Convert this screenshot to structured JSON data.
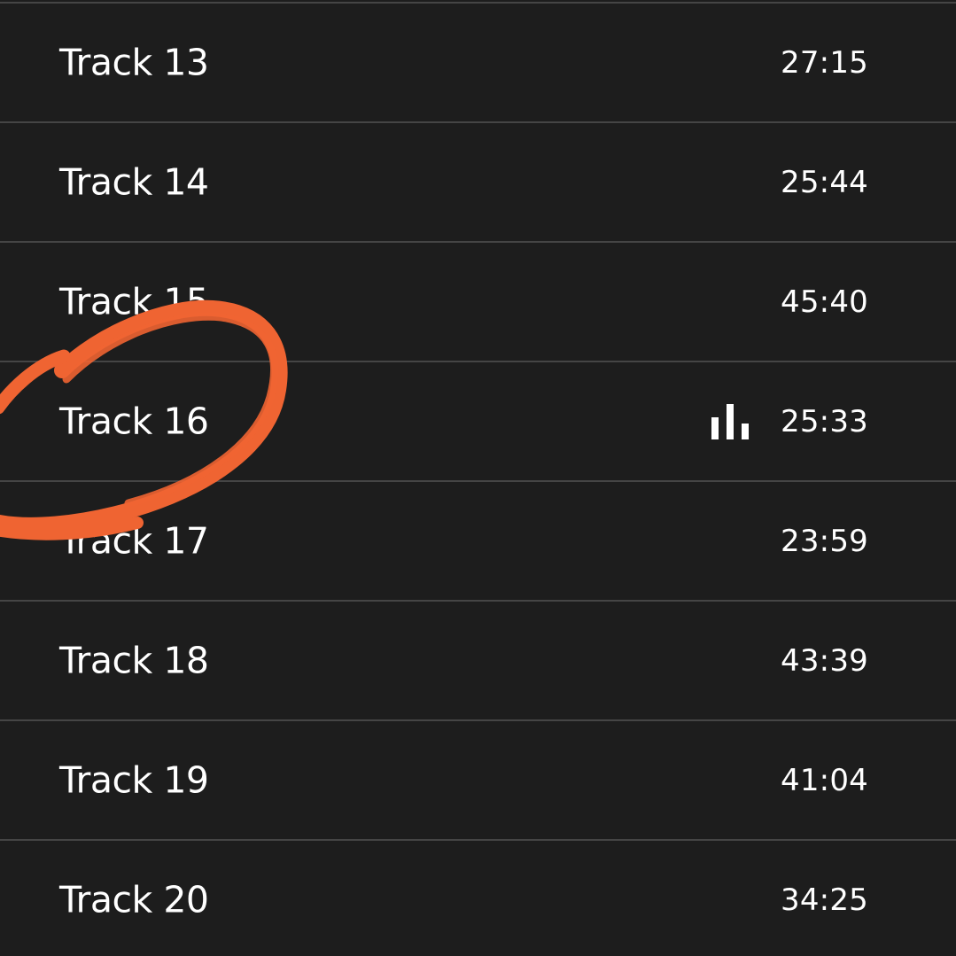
{
  "track_list": {
    "rows": [
      {
        "title": "Track 13",
        "duration": "27:15"
      },
      {
        "title": "Track 14",
        "duration": "25:44"
      },
      {
        "title": "Track 15",
        "duration": "45:40"
      },
      {
        "title": "Track 16",
        "duration": "25:33"
      },
      {
        "title": "Track 17",
        "duration": "23:59"
      },
      {
        "title": "Track 18",
        "duration": "43:39"
      },
      {
        "title": "Track 19",
        "duration": "41:04"
      },
      {
        "title": "Track 20",
        "duration": "34:25"
      }
    ],
    "now_playing_index": 3,
    "now_playing_icon": "now-playing-bars-icon"
  },
  "annotation": {
    "shape": "hand-drawn-circle",
    "color": "#ef6432",
    "highlights_row_index": 3
  },
  "colors": {
    "background": "#1d1d1d",
    "divider": "#454545",
    "text": "#ffffff",
    "annotation": "#ef6432"
  }
}
